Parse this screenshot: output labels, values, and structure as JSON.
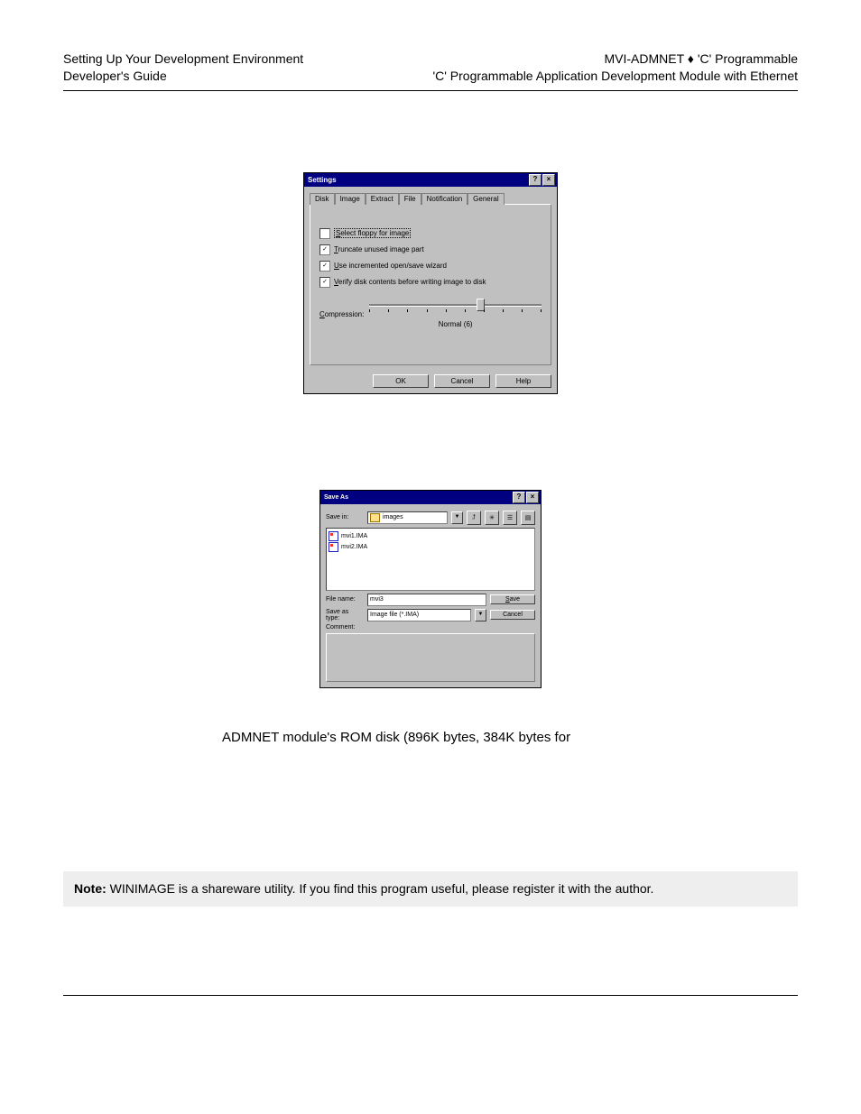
{
  "header": {
    "left1": "Setting Up Your Development Environment",
    "left2": "Developer's Guide",
    "right1": "MVI-ADMNET ♦ 'C' Programmable",
    "right2": "'C' Programmable Application Development Module with Ethernet"
  },
  "settings": {
    "title": "Settings",
    "help_btn": "?",
    "close_btn": "×",
    "tabs": [
      "Disk",
      "Image",
      "Extract",
      "File",
      "Notification",
      "General"
    ],
    "active_tab": 1,
    "opts": {
      "select_floppy": {
        "checked": false,
        "label": "Select floppy for image"
      },
      "truncate": {
        "checked": true,
        "label": "Truncate unused image part"
      },
      "incremented": {
        "checked": true,
        "label": "Use incremented open/save wizard"
      },
      "verify": {
        "checked": true,
        "label": "Verify disk contents before writing image to disk"
      }
    },
    "compression_label": "Compression:",
    "slider_text": "Normal (6)",
    "buttons": {
      "ok": "OK",
      "cancel": "Cancel",
      "help": "Help"
    }
  },
  "saveas": {
    "title": "Save As",
    "help_btn": "?",
    "close_btn": "×",
    "savein_label": "Save in:",
    "savein_value": "images",
    "files": [
      "mvi1.IMA",
      "mvi2.IMA"
    ],
    "filename_label": "File name:",
    "filename_value": "mvi3",
    "savetype_label": "Save as type:",
    "savetype_value": "Image file (*.IMA)",
    "comment_label": "Comment:",
    "save_btn": "Save",
    "cancel_btn": "Cancel"
  },
  "body_line": "ADMNET module's ROM disk (896K bytes, 384K bytes for",
  "note": {
    "bold": "Note:",
    "text": " WINIMAGE is a shareware utility. If you find this program useful, please register it with the author."
  }
}
